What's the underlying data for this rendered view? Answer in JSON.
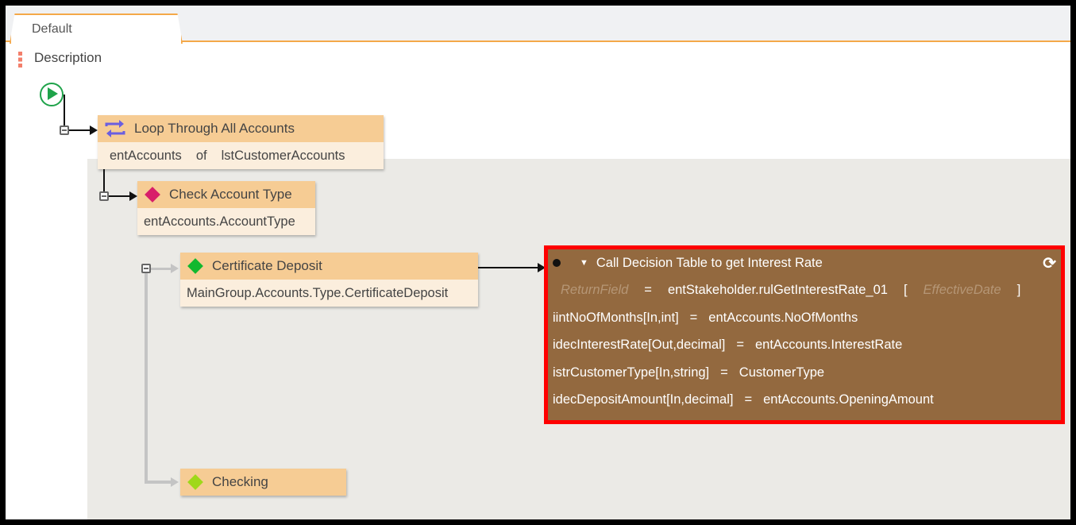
{
  "tab": {
    "label": "Default"
  },
  "description": {
    "label": "Description"
  },
  "nodes": {
    "loop": {
      "title": "Loop Through All Accounts",
      "item": "entAccounts",
      "of": "of",
      "collection": "lstCustomerAccounts"
    },
    "check": {
      "title": "Check Account Type",
      "expr": "entAccounts.AccountType"
    },
    "certificate": {
      "title": "Certificate Deposit",
      "expr": "MainGroup.Accounts.Type.CertificateDeposit"
    },
    "checking": {
      "title": "Checking"
    }
  },
  "decision_table": {
    "title": "Call Decision Table to get Interest Rate",
    "return_field": "ReturnField",
    "eq": "=",
    "rule": "entStakeholder.rulGetInterestRate_01",
    "open": "[",
    "effective_date": "EffectiveDate",
    "close": "]",
    "params": [
      {
        "name": "iintNoOfMonths[In,int]",
        "value": "entAccounts.NoOfMonths"
      },
      {
        "name": "idecInterestRate[Out,decimal]",
        "value": "entAccounts.InterestRate"
      },
      {
        "name": "istrCustomerType[In,string]",
        "value": "CustomerType"
      },
      {
        "name": "idecDepositAmount[In,decimal]",
        "value": "entAccounts.OpeningAmount"
      }
    ]
  },
  "colors": {
    "accent": "#f4a849",
    "node_header": "#f6cc94",
    "decision_bg": "#93693f",
    "highlight": "#ff0000"
  }
}
